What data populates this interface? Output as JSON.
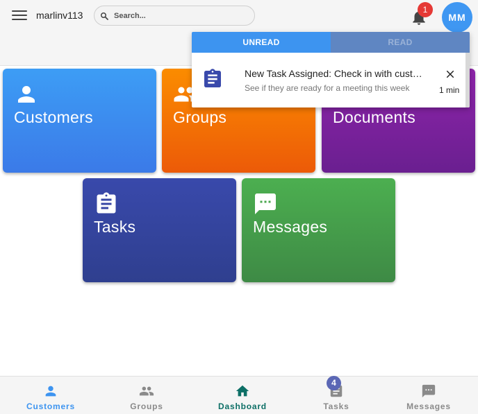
{
  "header": {
    "username": "marlinv113",
    "search_placeholder": "Search...",
    "notification_count": "1",
    "avatar_initials": "MM"
  },
  "tiles": [
    {
      "label": "Customers",
      "icon": "person-icon"
    },
    {
      "label": "Groups",
      "icon": "group-icon"
    },
    {
      "label": "Documents",
      "icon": "document-icon"
    },
    {
      "label": "Tasks",
      "icon": "clipboard-icon"
    },
    {
      "label": "Messages",
      "icon": "chat-icon"
    }
  ],
  "notifications": {
    "tabs": [
      "UNREAD",
      "READ"
    ],
    "active_tab": "UNREAD",
    "items": [
      {
        "title": "New Task Assigned: Check in with customers",
        "subtitle": "See if they are ready for a meeting this week",
        "time": "1 min",
        "icon": "clipboard-icon"
      }
    ]
  },
  "bottom_nav": {
    "items": [
      {
        "label": "Customers",
        "icon": "person-icon"
      },
      {
        "label": "Groups",
        "icon": "group-icon"
      },
      {
        "label": "Dashboard",
        "icon": "home-icon"
      },
      {
        "label": "Tasks",
        "icon": "clipboard-icon"
      },
      {
        "label": "Messages",
        "icon": "chat-icon"
      }
    ],
    "tasks_badge": "4",
    "active": "Dashboard"
  },
  "colors": {
    "primary_blue": "#3d94f0",
    "orange": "#fb8c00",
    "purple": "#8e24aa",
    "indigo": "#3949ab",
    "green": "#4caf50",
    "teal": "#0d6f66",
    "badge_red": "#e53935"
  }
}
